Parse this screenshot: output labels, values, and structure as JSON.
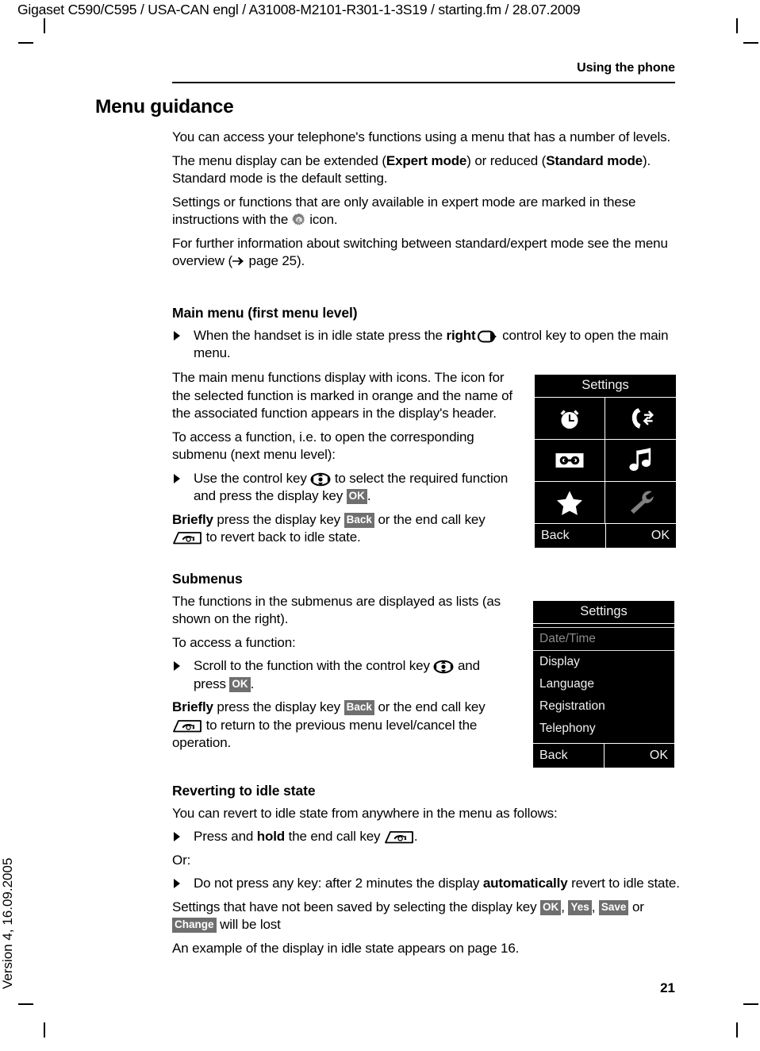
{
  "header": {
    "file_line": "Gigaset C590/C595 / USA-CAN engl / A31008-M2101-R301-1-3S19 / starting.fm / 28.07.2009",
    "running_head": "Using the phone"
  },
  "margin": {
    "version": "Version 4, 16.09.2005"
  },
  "page": {
    "number": "21"
  },
  "title": "Menu guidance",
  "intro": {
    "p1": "You can access your telephone's functions using a menu that has a number of levels.",
    "p2_a": "The menu display can be extended (",
    "p2_b": "Expert mode",
    "p2_c": ") or reduced (",
    "p2_d": "Standard mode",
    "p2_e": "). Standard mode is the default setting.",
    "p3_a": "Settings or functions that are only available in expert mode are marked in these instructions with the ",
    "p3_b": " icon.",
    "p4_a": "For further information about switching between standard/expert mode see the menu overview (",
    "p4_b": " page 25)."
  },
  "main_menu": {
    "heading": "Main menu (first menu level)",
    "bullet_a": "When the handset is in idle state press the ",
    "bullet_b": "right",
    "bullet_c": " control key to open the main menu.",
    "p1": "The main menu functions display with icons. The icon for the selected function is marked in orange and the name of the associated function appears in the display's header.",
    "p2": "To access a function, i.e. to open the corresponding submenu (next menu level):",
    "bullet2_a": "Use the control key ",
    "bullet2_b": " to select the required function and press the display key ",
    "bullet2_key": "OK",
    "bullet2_c": ".",
    "p3_a": "Briefly",
    "p3_b": " press the display key ",
    "p3_key": "Back",
    "p3_c": " or the end call key ",
    "p3_d": " to revert back to idle state."
  },
  "submenus": {
    "heading": "Submenus",
    "p1": "The functions in the submenus are displayed as lists (as shown on the right).",
    "p2": "To access a function:",
    "bullet_a": "Scroll to the function with the control key ",
    "bullet_b": " and press ",
    "bullet_key": "OK",
    "bullet_c": ".",
    "p3_a": "Briefly",
    "p3_b": " press the display key ",
    "p3_key": "Back",
    "p3_c": " or the end call key ",
    "p3_d": " to return to the previous menu level/cancel the operation."
  },
  "reverting": {
    "heading": "Reverting to idle state",
    "p1": "You can revert to idle state from anywhere in the menu as follows:",
    "bullet1_a": "Press and ",
    "bullet1_b": "hold",
    "bullet1_c": " the end call key ",
    "bullet1_d": ".",
    "or": "Or:",
    "bullet2_a": "Do not press any key: after 2 minutes the display ",
    "bullet2_b": "automatically",
    "bullet2_c": " revert to idle state.",
    "p2_a": "Settings that have not been saved by selecting the display key ",
    "p2_key1": "OK",
    "p2_sep1": ", ",
    "p2_key2": "Yes",
    "p2_sep2": ", ",
    "p2_key3": "Save",
    "p2_mid": " or ",
    "p2_key4": "Change",
    "p2_end": " will be lost",
    "p3": "An example of the display in idle state appears on page 16."
  },
  "display_main": {
    "title": "Settings",
    "icons": [
      {
        "name": "alarm-clock-icon",
        "label": "Alarm clock",
        "selected": false
      },
      {
        "name": "call-forward-icon",
        "label": "Call forwarding",
        "selected": false
      },
      {
        "name": "answering-machine-icon",
        "label": "Answering machine",
        "selected": false
      },
      {
        "name": "music-note-icon",
        "label": "Audio settings",
        "selected": false
      },
      {
        "name": "star-icon",
        "label": "Additional features",
        "selected": false
      },
      {
        "name": "wrench-icon",
        "label": "Settings",
        "selected": true
      }
    ],
    "softkey_left": "Back",
    "softkey_right": "OK",
    "selected_color": "#808080",
    "icon_color": "#ffffff"
  },
  "display_sub": {
    "title": "Settings",
    "items": [
      {
        "label": "Date/Time",
        "selected": true
      },
      {
        "label": "Display",
        "selected": false
      },
      {
        "label": "Language",
        "selected": false
      },
      {
        "label": "Registration",
        "selected": false
      },
      {
        "label": "Telephony",
        "selected": false
      }
    ],
    "softkey_left": "Back",
    "softkey_right": "OK",
    "selected_color": "#8a8a8a"
  },
  "icons": {
    "expert_gear": "expert-mode-gear-icon",
    "control_right": "control-key-right-icon",
    "control_4way": "control-key-4way-icon",
    "end_call": "end-call-key-icon",
    "arrow_right": "arrow-right-icon"
  }
}
